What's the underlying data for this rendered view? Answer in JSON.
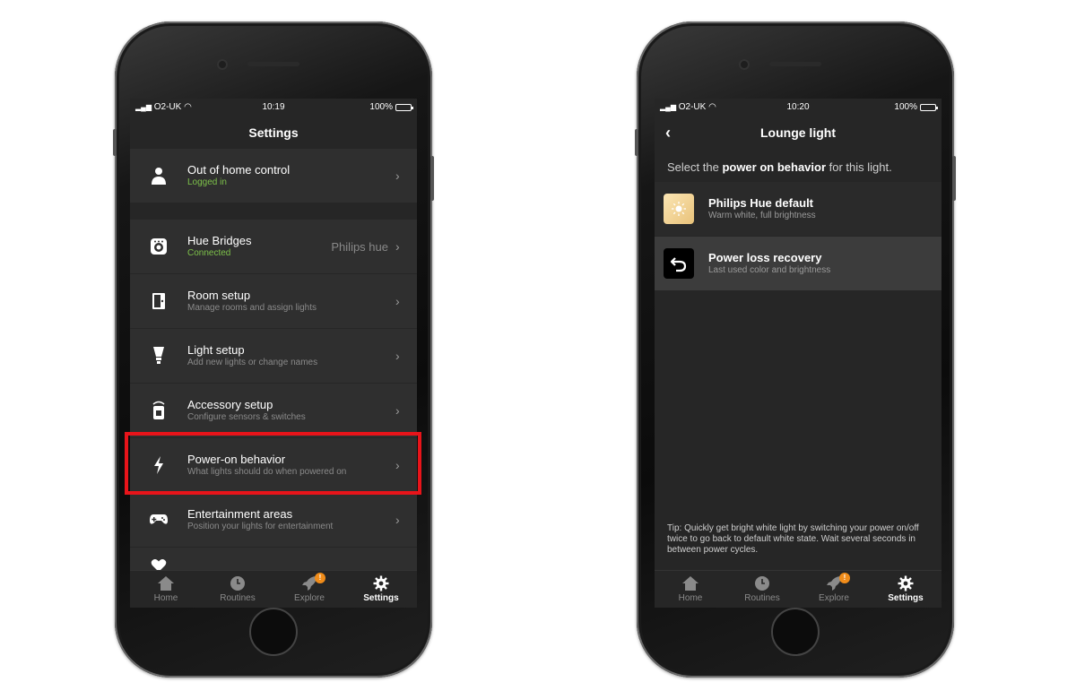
{
  "left_phone": {
    "status": {
      "carrier": "O2-UK",
      "time": "10:19",
      "battery": "100%"
    },
    "nav_title": "Settings",
    "rows": [
      {
        "title": "Out of home control",
        "sub": "Logged in",
        "value": ""
      },
      {
        "title": "Hue Bridges",
        "sub": "Connected",
        "value": "Philips hue"
      },
      {
        "title": "Room setup",
        "sub": "Manage rooms and assign lights",
        "value": ""
      },
      {
        "title": "Light setup",
        "sub": "Add new lights or change names",
        "value": ""
      },
      {
        "title": "Accessory setup",
        "sub": "Configure sensors & switches",
        "value": ""
      },
      {
        "title": "Power-on behavior",
        "sub": "What lights should do when powered on",
        "value": ""
      },
      {
        "title": "Entertainment areas",
        "sub": "Position your lights for entertainment",
        "value": ""
      }
    ],
    "tabs": [
      "Home",
      "Routines",
      "Explore",
      "Settings"
    ],
    "explore_badge": "!"
  },
  "right_phone": {
    "status": {
      "carrier": "O2-UK",
      "time": "10:20",
      "battery": "100%"
    },
    "nav_title": "Lounge light",
    "prompt_pre": "Select the ",
    "prompt_bold": "power on behavior",
    "prompt_post": " for this light.",
    "options": [
      {
        "title": "Philips Hue default",
        "sub": "Warm white, full brightness"
      },
      {
        "title": "Power loss recovery",
        "sub": "Last used color and brightness"
      }
    ],
    "tip": "Tip: Quickly get bright white light by switching your power on/off twice to go back to default white state. Wait several seconds in between power cycles.",
    "tabs": [
      "Home",
      "Routines",
      "Explore",
      "Settings"
    ],
    "explore_badge": "!"
  },
  "colors": {
    "highlight": "#e8141a",
    "status_green": "#7dc14a",
    "badge_orange": "#f08c1a"
  }
}
